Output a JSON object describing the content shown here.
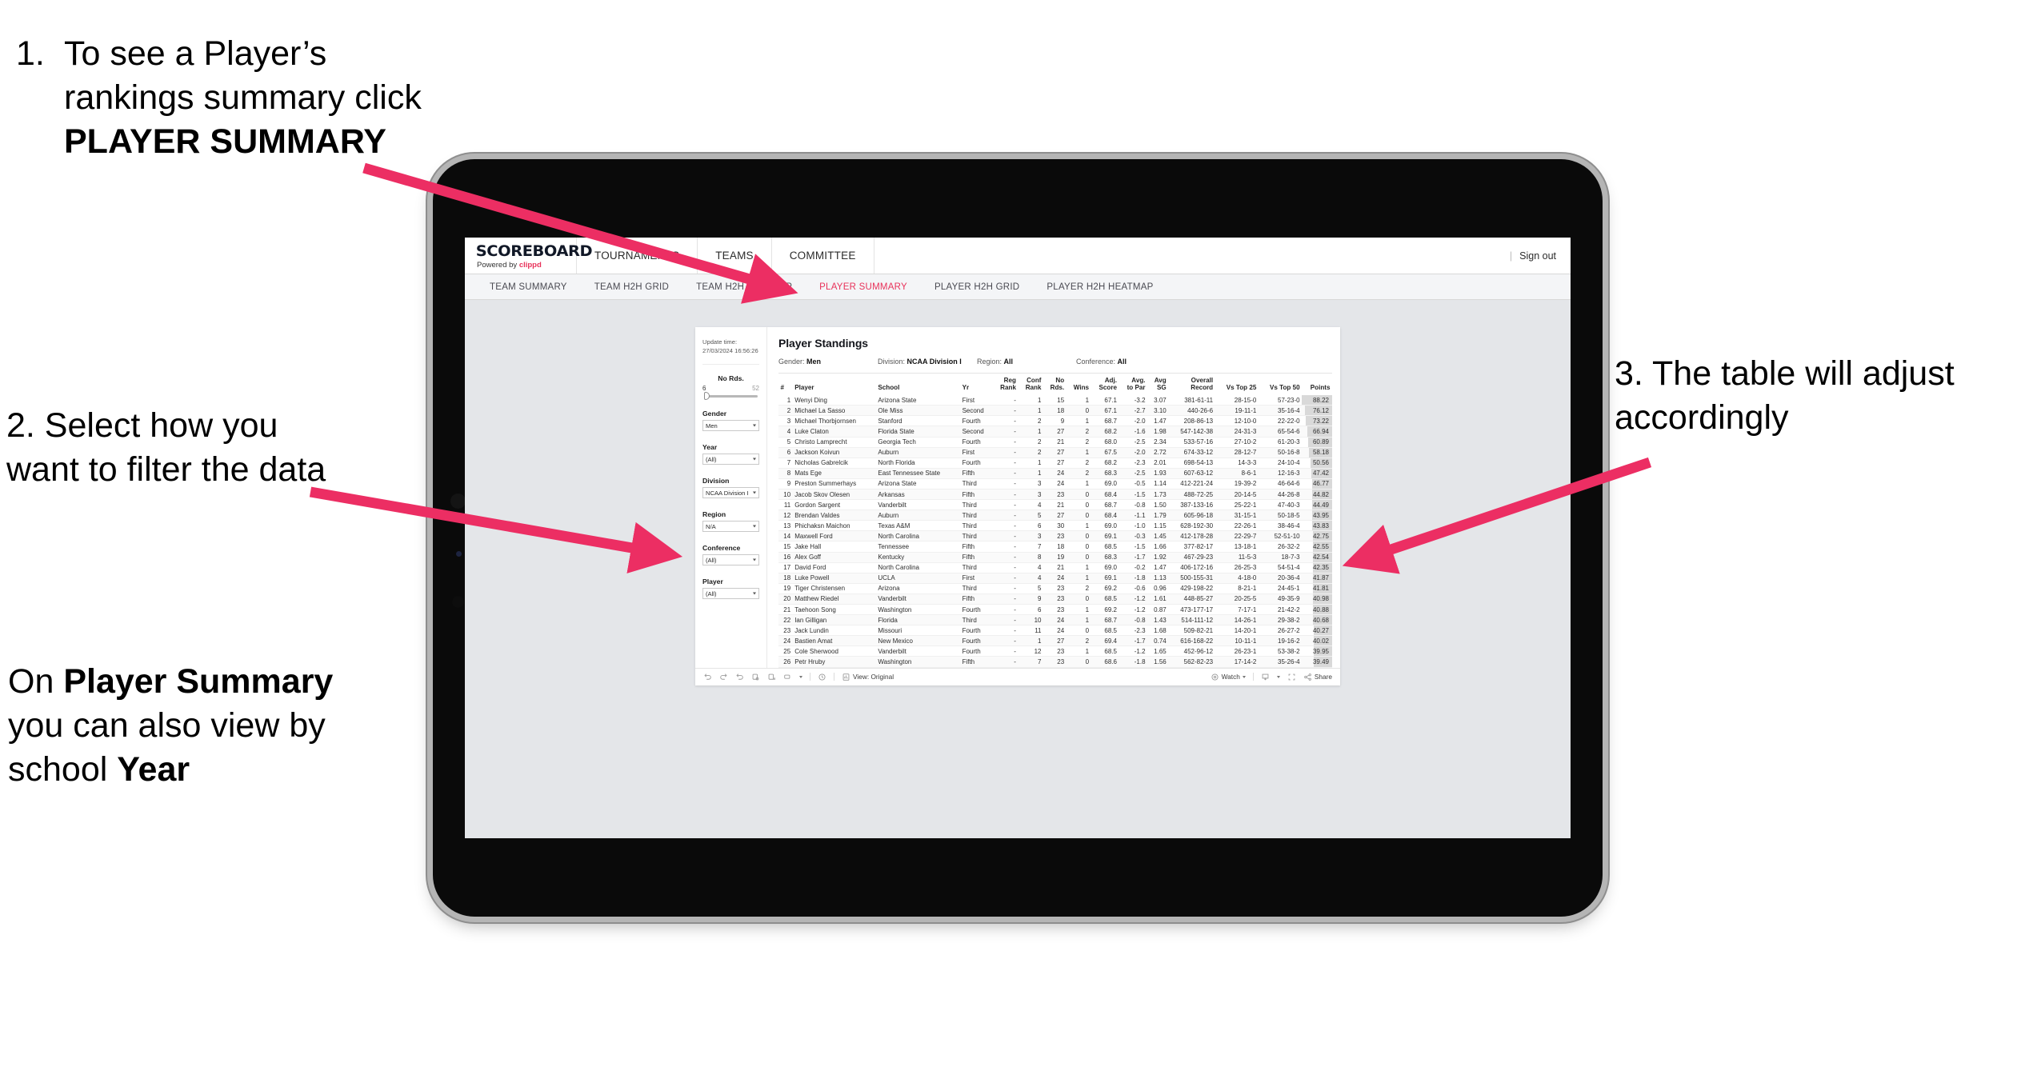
{
  "annotations": {
    "step1": {
      "number": "1.",
      "line1": "To see a Player’s rankings",
      "line2_pre": "summary click ",
      "line2_bold": "PLAYER SUMMARY"
    },
    "step2": {
      "text": "2. Select how you want to filter the data"
    },
    "step3": {
      "pre": "On ",
      "bold1": "Player Summary",
      "mid": " you can also view by school ",
      "bold2": "Year"
    },
    "step4": {
      "text": "3. The table will adjust accordingly"
    }
  },
  "app": {
    "brand": {
      "logo": "SCOREBOARD",
      "powered_pre": "Powered by ",
      "powered_brand": "clippd"
    },
    "top_nav": [
      "TOURNAMENTS",
      "TEAMS",
      "COMMITTEE"
    ],
    "top_right": {
      "divider": "|",
      "sign_out": "Sign out"
    },
    "sub_nav": [
      {
        "label": "TEAM SUMMARY",
        "active": false
      },
      {
        "label": "TEAM H2H GRID",
        "active": false
      },
      {
        "label": "TEAM H2H HEATMAP",
        "active": false
      },
      {
        "label": "PLAYER SUMMARY",
        "active": true
      },
      {
        "label": "PLAYER H2H GRID",
        "active": false
      },
      {
        "label": "PLAYER H2H HEATMAP",
        "active": false
      }
    ],
    "accent_color": "#e8325a"
  },
  "filters": {
    "update_label": "Update time:",
    "update_value": "27/03/2024 16:56:26",
    "no_rds": {
      "label": "No Rds.",
      "min": "6",
      "max": "52"
    },
    "items": [
      {
        "label": "Gender",
        "value": "Men"
      },
      {
        "label": "Year",
        "value": "(All)"
      },
      {
        "label": "Division",
        "value": "NCAA Division I"
      },
      {
        "label": "Region",
        "value": "N/A"
      },
      {
        "label": "Conference",
        "value": "(All)"
      },
      {
        "label": "Player",
        "value": "(All)"
      }
    ]
  },
  "viz": {
    "title": "Player Standings",
    "summary": [
      {
        "label": "Gender:",
        "value": "Men"
      },
      {
        "label": "Division:",
        "value": "NCAA Division I"
      },
      {
        "label": "Region:",
        "value": "All"
      },
      {
        "label": "Conference:",
        "value": "All"
      }
    ],
    "columns": [
      "#",
      "Player",
      "School",
      "Yr",
      "Reg Rank",
      "Conf Rank",
      "No Rds.",
      "Wins",
      "Adj. Score",
      "Avg. to Par",
      "Avg SG",
      "Overall Record",
      "Vs Top 25",
      "Vs Top 50",
      "Points"
    ],
    "rows": [
      [
        "1",
        "Wenyi Ding",
        "Arizona State",
        "First",
        "-",
        "1",
        "15",
        "1",
        "67.1",
        "-3.2",
        "3.07",
        "381-61-11",
        "28-15-0",
        "57-23-0",
        "88.22"
      ],
      [
        "2",
        "Michael La Sasso",
        "Ole Miss",
        "Second",
        "-",
        "1",
        "18",
        "0",
        "67.1",
        "-2.7",
        "3.10",
        "440-26-6",
        "19-11-1",
        "35-16-4",
        "76.12"
      ],
      [
        "3",
        "Michael Thorbjornsen",
        "Stanford",
        "Fourth",
        "-",
        "2",
        "9",
        "1",
        "68.7",
        "-2.0",
        "1.47",
        "208-86-13",
        "12-10-0",
        "22-22-0",
        "73.22"
      ],
      [
        "4",
        "Luke Claton",
        "Florida State",
        "Second",
        "-",
        "1",
        "27",
        "2",
        "68.2",
        "-1.6",
        "1.98",
        "547-142-38",
        "24-31-3",
        "65-54-6",
        "66.94"
      ],
      [
        "5",
        "Christo Lamprecht",
        "Georgia Tech",
        "Fourth",
        "-",
        "2",
        "21",
        "2",
        "68.0",
        "-2.5",
        "2.34",
        "533-57-16",
        "27-10-2",
        "61-20-3",
        "60.89"
      ],
      [
        "6",
        "Jackson Koivun",
        "Auburn",
        "First",
        "-",
        "2",
        "27",
        "1",
        "67.5",
        "-2.0",
        "2.72",
        "674-33-12",
        "28-12-7",
        "50-16-8",
        "58.18"
      ],
      [
        "7",
        "Nicholas Gabrelcik",
        "North Florida",
        "Fourth",
        "-",
        "1",
        "27",
        "2",
        "68.2",
        "-2.3",
        "2.01",
        "698-54-13",
        "14-3-3",
        "24-10-4",
        "50.56"
      ],
      [
        "8",
        "Mats Ege",
        "East Tennessee State",
        "Fifth",
        "-",
        "1",
        "24",
        "2",
        "68.3",
        "-2.5",
        "1.93",
        "607-63-12",
        "8-6-1",
        "12-16-3",
        "47.42"
      ],
      [
        "9",
        "Preston Summerhays",
        "Arizona State",
        "Third",
        "-",
        "3",
        "24",
        "1",
        "69.0",
        "-0.5",
        "1.14",
        "412-221-24",
        "19-39-2",
        "46-64-6",
        "46.77"
      ],
      [
        "10",
        "Jacob Skov Olesen",
        "Arkansas",
        "Fifth",
        "-",
        "3",
        "23",
        "0",
        "68.4",
        "-1.5",
        "1.73",
        "488-72-25",
        "20-14-5",
        "44-26-8",
        "44.82"
      ],
      [
        "11",
        "Gordon Sargent",
        "Vanderbilt",
        "Third",
        "-",
        "4",
        "21",
        "0",
        "68.7",
        "-0.8",
        "1.50",
        "387-133-16",
        "25-22-1",
        "47-40-3",
        "44.49"
      ],
      [
        "12",
        "Brendan Valdes",
        "Auburn",
        "Third",
        "-",
        "5",
        "27",
        "0",
        "68.4",
        "-1.1",
        "1.79",
        "605-96-18",
        "31-15-1",
        "50-18-5",
        "43.95"
      ],
      [
        "13",
        "Phichaksn Maichon",
        "Texas A&M",
        "Third",
        "-",
        "6",
        "30",
        "1",
        "69.0",
        "-1.0",
        "1.15",
        "628-192-30",
        "22-26-1",
        "38-46-4",
        "43.83"
      ],
      [
        "14",
        "Maxwell Ford",
        "North Carolina",
        "Third",
        "-",
        "3",
        "23",
        "0",
        "69.1",
        "-0.3",
        "1.45",
        "412-178-28",
        "22-29-7",
        "52-51-10",
        "42.75"
      ],
      [
        "15",
        "Jake Hall",
        "Tennessee",
        "Fifth",
        "-",
        "7",
        "18",
        "0",
        "68.5",
        "-1.5",
        "1.66",
        "377-82-17",
        "13-18-1",
        "26-32-2",
        "42.55"
      ],
      [
        "16",
        "Alex Goff",
        "Kentucky",
        "Fifth",
        "-",
        "8",
        "19",
        "0",
        "68.3",
        "-1.7",
        "1.92",
        "467-29-23",
        "11-5-3",
        "18-7-3",
        "42.54"
      ],
      [
        "17",
        "David Ford",
        "North Carolina",
        "Third",
        "-",
        "4",
        "21",
        "1",
        "69.0",
        "-0.2",
        "1.47",
        "406-172-16",
        "26-25-3",
        "54-51-4",
        "42.35"
      ],
      [
        "18",
        "Luke Powell",
        "UCLA",
        "First",
        "-",
        "4",
        "24",
        "1",
        "69.1",
        "-1.8",
        "1.13",
        "500-155-31",
        "4-18-0",
        "20-36-4",
        "41.87"
      ],
      [
        "19",
        "Tiger Christensen",
        "Arizona",
        "Third",
        "-",
        "5",
        "23",
        "2",
        "69.2",
        "-0.6",
        "0.96",
        "429-198-22",
        "8-21-1",
        "24-45-1",
        "41.81"
      ],
      [
        "20",
        "Matthew Riedel",
        "Vanderbilt",
        "Fifth",
        "-",
        "9",
        "23",
        "0",
        "68.5",
        "-1.2",
        "1.61",
        "448-85-27",
        "20-25-5",
        "49-35-9",
        "40.98"
      ],
      [
        "21",
        "Taehoon Song",
        "Washington",
        "Fourth",
        "-",
        "6",
        "23",
        "1",
        "69.2",
        "-1.2",
        "0.87",
        "473-177-17",
        "7-17-1",
        "21-42-2",
        "40.88"
      ],
      [
        "22",
        "Ian Gilligan",
        "Florida",
        "Third",
        "-",
        "10",
        "24",
        "1",
        "68.7",
        "-0.8",
        "1.43",
        "514-111-12",
        "14-26-1",
        "29-38-2",
        "40.68"
      ],
      [
        "23",
        "Jack Lundin",
        "Missouri",
        "Fourth",
        "-",
        "11",
        "24",
        "0",
        "68.5",
        "-2.3",
        "1.68",
        "509-82-21",
        "14-20-1",
        "26-27-2",
        "40.27"
      ],
      [
        "24",
        "Bastien Amat",
        "New Mexico",
        "Fourth",
        "-",
        "1",
        "27",
        "2",
        "69.4",
        "-1.7",
        "0.74",
        "616-168-22",
        "10-11-1",
        "19-16-2",
        "40.02"
      ],
      [
        "25",
        "Cole Sherwood",
        "Vanderbilt",
        "Fourth",
        "-",
        "12",
        "23",
        "1",
        "68.5",
        "-1.2",
        "1.65",
        "452-96-12",
        "26-23-1",
        "53-38-2",
        "39.95"
      ],
      [
        "26",
        "Petr Hruby",
        "Washington",
        "Fifth",
        "-",
        "7",
        "23",
        "0",
        "68.6",
        "-1.8",
        "1.56",
        "562-82-23",
        "17-14-2",
        "35-26-4",
        "39.49"
      ]
    ]
  },
  "footer": {
    "view_label": "View: Original",
    "watch_label": "Watch",
    "share_label": "Share"
  }
}
